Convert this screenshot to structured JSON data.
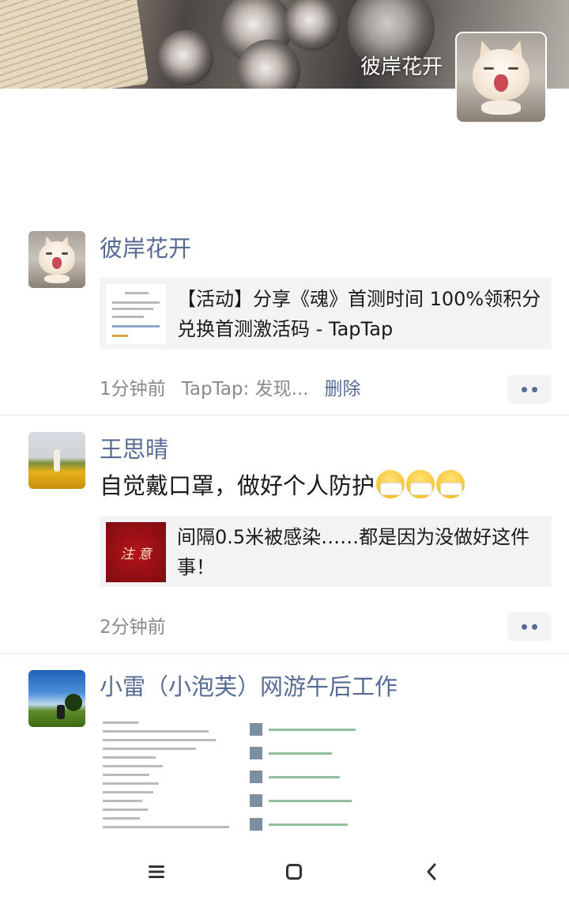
{
  "profile": {
    "username": "彼岸花开"
  },
  "posts": [
    {
      "author": "彼岸花开",
      "link": {
        "title": "【活动】分享《魂》首测时间 100%领积分兑换首测激活码 - TapTap"
      },
      "time": "1分钟前",
      "source": "TapTap: 发现...",
      "delete_label": "删除"
    },
    {
      "author": "王思晴",
      "text": "自觉戴口罩，做好个人防护",
      "emoji": [
        "mask-emoji",
        "mask-emoji",
        "mask-emoji"
      ],
      "link": {
        "title": "间隔0.5米被感染……都是因为没做好这件事！",
        "thumb_label": "注 意"
      },
      "time": "2分钟前"
    },
    {
      "author": "小雷（小泡芙）网游午后工作"
    }
  ],
  "navbar": {
    "icons": [
      "menu-icon",
      "home-square-icon",
      "back-chevron-icon"
    ]
  },
  "colors": {
    "link_blue": "#576b95",
    "meta_gray": "#8a8a8a",
    "card_bg": "#f3f3f5"
  }
}
